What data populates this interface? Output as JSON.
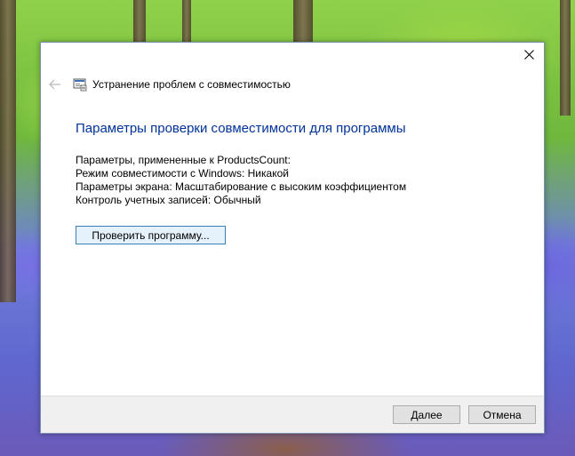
{
  "header": {
    "title": "Устранение проблем с совместимостью",
    "back_icon": "back-arrow-icon",
    "app_icon": "troubleshooter-icon",
    "close_icon": "close-icon"
  },
  "main": {
    "heading": "Параметры проверки совместимости для программы",
    "params": [
      "Параметры, примененные к  ProductsCount:",
      "Режим совместимости с Windows: Никакой",
      "Параметры экрана:  Масштабирование с высоким коэффициентом",
      "Контроль учетных записей:  Обычный"
    ],
    "test_button_label": "Проверить программу..."
  },
  "footer": {
    "next_label": "Далее",
    "cancel_label": "Отмена"
  },
  "colors": {
    "heading": "#003399",
    "accent_border": "#3c7fb1"
  }
}
